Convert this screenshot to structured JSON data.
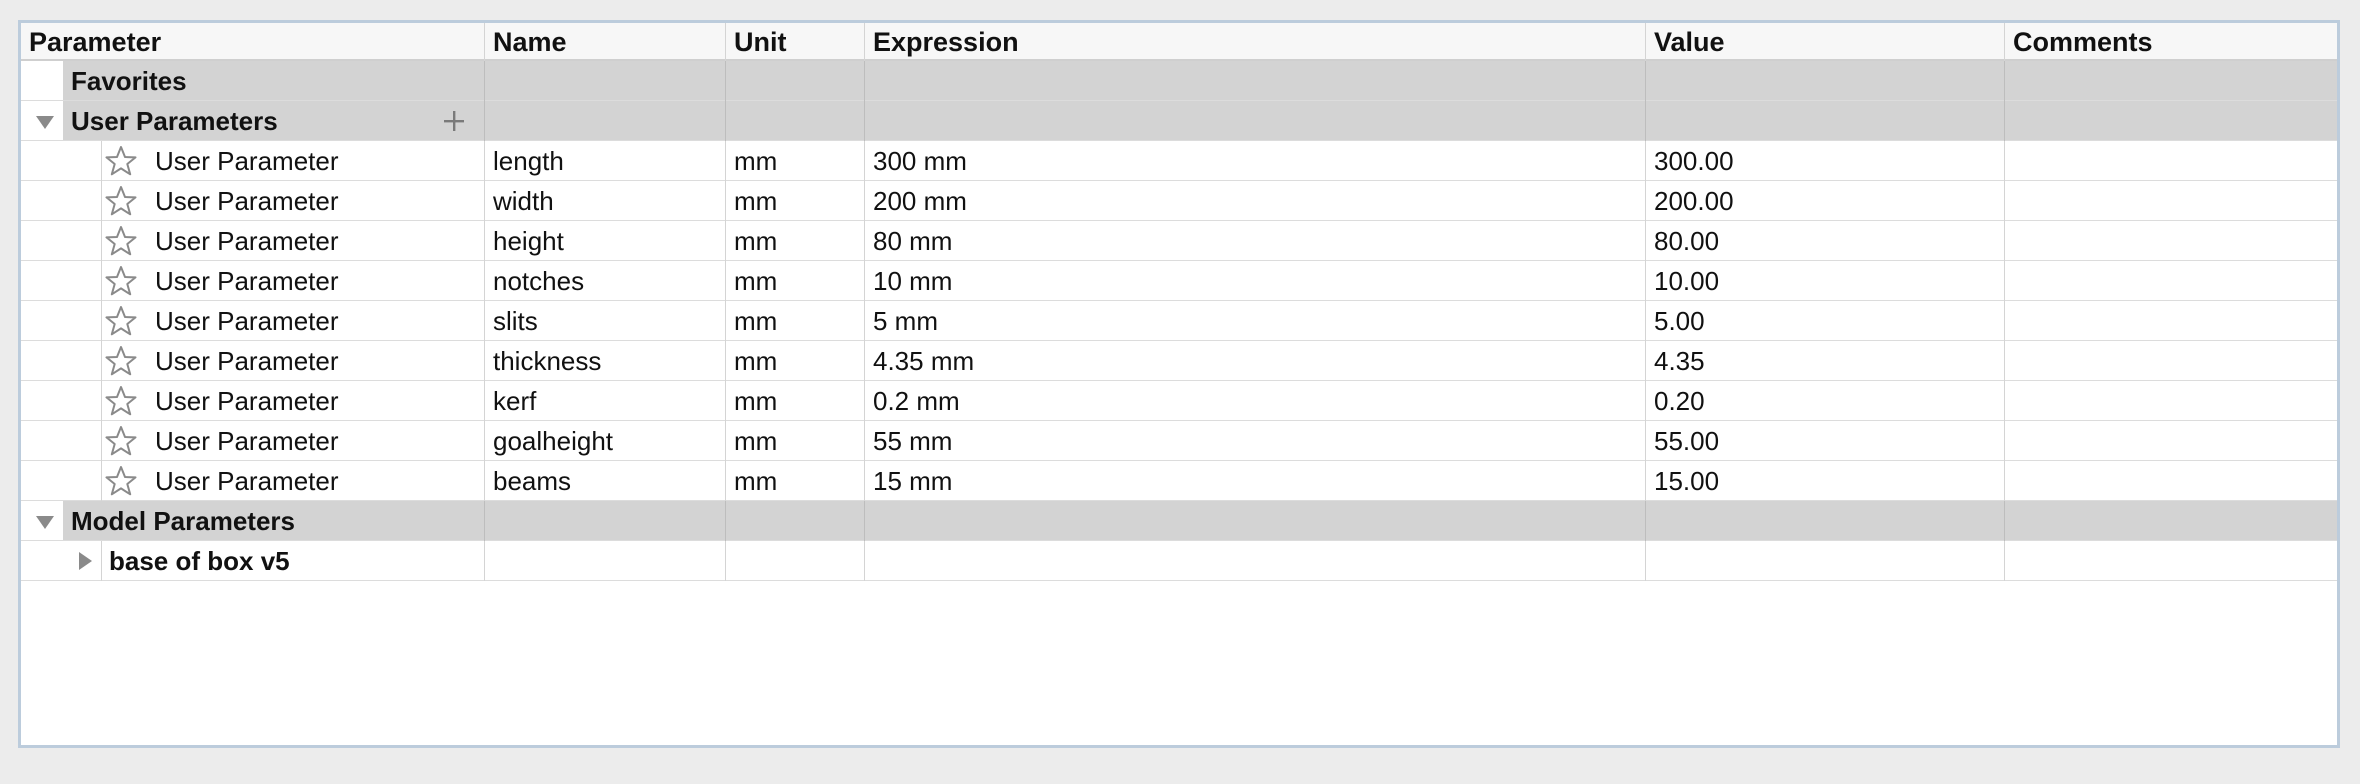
{
  "columns": {
    "parameter": "Parameter",
    "name": "Name",
    "unit": "Unit",
    "expression": "Expression",
    "value": "Value",
    "comments": "Comments"
  },
  "groups": {
    "favorites": "Favorites",
    "user_parameters": "User Parameters",
    "model_parameters": "Model Parameters"
  },
  "user_params": [
    {
      "type": "User Parameter",
      "name": "length",
      "unit": "mm",
      "expression": "300 mm",
      "value": "300.00",
      "comments": ""
    },
    {
      "type": "User Parameter",
      "name": "width",
      "unit": "mm",
      "expression": "200 mm",
      "value": "200.00",
      "comments": ""
    },
    {
      "type": "User Parameter",
      "name": "height",
      "unit": "mm",
      "expression": "80 mm",
      "value": "80.00",
      "comments": ""
    },
    {
      "type": "User Parameter",
      "name": "notches",
      "unit": "mm",
      "expression": "10 mm",
      "value": "10.00",
      "comments": ""
    },
    {
      "type": "User Parameter",
      "name": "slits",
      "unit": "mm",
      "expression": "5 mm",
      "value": "5.00",
      "comments": ""
    },
    {
      "type": "User Parameter",
      "name": "thickness",
      "unit": "mm",
      "expression": "4.35 mm",
      "value": "4.35",
      "comments": ""
    },
    {
      "type": "User Parameter",
      "name": "kerf",
      "unit": "mm",
      "expression": "0.2 mm",
      "value": "0.20",
      "comments": ""
    },
    {
      "type": "User Parameter",
      "name": "goalheight",
      "unit": "mm",
      "expression": "55 mm",
      "value": "55.00",
      "comments": ""
    },
    {
      "type": "User Parameter",
      "name": "beams",
      "unit": "mm",
      "expression": "15 mm",
      "value": "15.00",
      "comments": ""
    }
  ],
  "model_components": [
    {
      "name": "base of box v5"
    }
  ],
  "icons": {
    "favorite": "star-outline-icon",
    "add": "plus-icon",
    "expanded": "triangle-down-icon",
    "collapsed": "triangle-right-icon"
  },
  "colors": {
    "group_header_bg": "#d3d3d3",
    "panel_border": "#bcccdc",
    "star_stroke": "#8a8a8a"
  }
}
